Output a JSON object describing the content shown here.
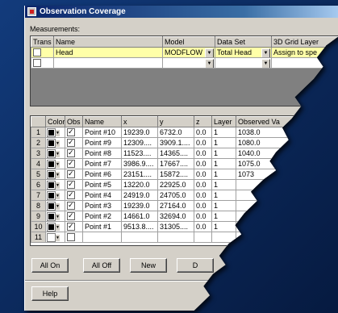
{
  "window": {
    "title": "Observation Coverage",
    "icon": "window-icon"
  },
  "measurements": {
    "label": "Measurements:",
    "columns": [
      "Trans",
      "Name",
      "Model",
      "Data Set",
      "3D Grid Layer"
    ],
    "rows": [
      {
        "trans": false,
        "name": "Head",
        "model": "MODFLOW",
        "dataset": "Total Head",
        "layer": "Assign to spe"
      },
      {
        "trans": false,
        "name": "",
        "model": "",
        "dataset": "",
        "layer": ""
      }
    ]
  },
  "points": {
    "columns": [
      "Color",
      "Obs",
      "Name",
      "x",
      "y",
      "z",
      "Layer",
      "Observed Va"
    ],
    "rows": [
      {
        "n": "1",
        "color": "black",
        "obs": true,
        "name": "Point #10",
        "x": "19239.0",
        "y": "6732.0",
        "z": "0.0",
        "layer": "1",
        "observed": "1038.0"
      },
      {
        "n": "2",
        "color": "black",
        "obs": true,
        "name": "Point #9",
        "x": "12309....",
        "y": "3909.1....",
        "z": "0.0",
        "layer": "1",
        "observed": "1080.0"
      },
      {
        "n": "3",
        "color": "black",
        "obs": true,
        "name": "Point #8",
        "x": "11523....",
        "y": "14365....",
        "z": "0.0",
        "layer": "1",
        "observed": "1040.0"
      },
      {
        "n": "4",
        "color": "black",
        "obs": true,
        "name": "Point #7",
        "x": "3986.9....",
        "y": "17667....",
        "z": "0.0",
        "layer": "1",
        "observed": "1075.0"
      },
      {
        "n": "5",
        "color": "black",
        "obs": true,
        "name": "Point #6",
        "x": "23151....",
        "y": "15872....",
        "z": "0.0",
        "layer": "1",
        "observed": "1073"
      },
      {
        "n": "6",
        "color": "black",
        "obs": true,
        "name": "Point #5",
        "x": "13220.0",
        "y": "22925.0",
        "z": "0.0",
        "layer": "1",
        "observed": ""
      },
      {
        "n": "7",
        "color": "black",
        "obs": true,
        "name": "Point #4",
        "x": "24919.0",
        "y": "24705.0",
        "z": "0.0",
        "layer": "1",
        "observed": ""
      },
      {
        "n": "8",
        "color": "black",
        "obs": true,
        "name": "Point #3",
        "x": "19239.0",
        "y": "27164.0",
        "z": "0.0",
        "layer": "1",
        "observed": ""
      },
      {
        "n": "9",
        "color": "black",
        "obs": true,
        "name": "Point #2",
        "x": "14661.0",
        "y": "32694.0",
        "z": "0.0",
        "layer": "1",
        "observed": ""
      },
      {
        "n": "10",
        "color": "black",
        "obs": true,
        "name": "Point #1",
        "x": "9513.8....",
        "y": "31305....",
        "z": "0.0",
        "layer": "1",
        "observed": ""
      },
      {
        "n": "11",
        "color": "white",
        "obs": false,
        "name": "",
        "x": "",
        "y": "",
        "z": "",
        "layer": "",
        "observed": ""
      }
    ]
  },
  "buttons": {
    "all_on": "All On",
    "all_off": "All Off",
    "new": "New",
    "delete": "D",
    "help": "Help"
  },
  "colors": {
    "highlight_row": "#ffffa8",
    "window_bg": "#d4d0c8",
    "desktop": "#0c2d64"
  }
}
